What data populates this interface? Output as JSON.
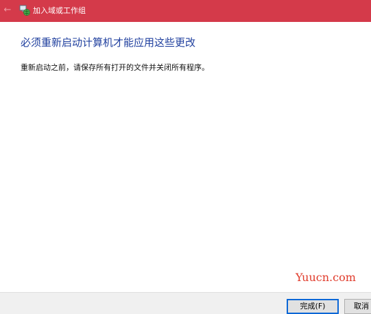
{
  "window": {
    "title": "加入域或工作组",
    "back_icon": "←",
    "app_icon": "network-globe-icon"
  },
  "main": {
    "heading": "必须重新启动计算机才能应用这些更改",
    "instruction": "重新启动之前，请保存所有打开的文件并关闭所有程序。"
  },
  "watermark": "Yuucn.com",
  "footer": {
    "finish_label": "完成(F)",
    "cancel_label": "取消"
  },
  "colors": {
    "titlebar": "#d43a4a",
    "heading": "#1f3f9e",
    "watermark": "#e03a2a",
    "primary_button_border": "#0a66d6"
  }
}
